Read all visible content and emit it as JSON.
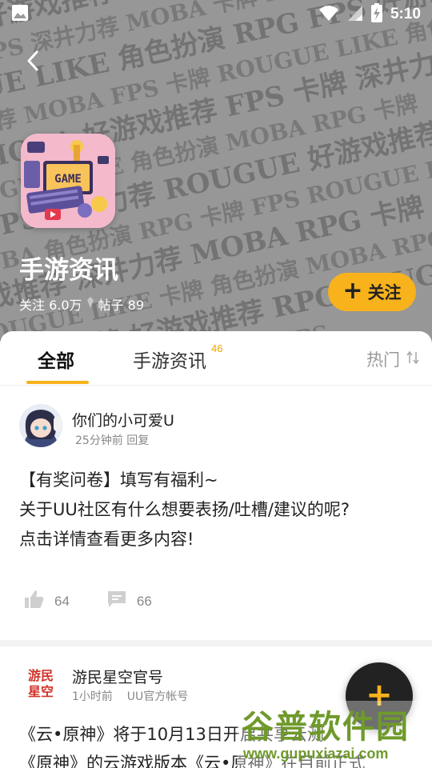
{
  "status_bar": {
    "time": "5:10"
  },
  "background_words": [
    "MOBA 好游戏推荐 角色扮演 卡牌 ROUGUE LIKE",
    "RPG FPS 深井力荐 MOBA 卡牌 ROUGUE",
    "ROUGUE LIKE 角色扮演 RPG FPS 好游戏推荐",
    "深井力荐 MOBA FPS 卡牌 ROUGUE LIKE 角色扮演",
    "RPG MOBA 好游戏推荐 FPS 卡牌 深井力荐",
    "ROUGUE LIKE 角色扮演 MOBA RPG 卡牌",
    "卡牌 FPS 深井力荐 ROUGUE 好游戏推荐 RPG",
    "MOBA 角色扮演 RPG 卡牌 FPS ROUGUE LIKE",
    "好游戏推荐 深井力荐 MOBA RPG 卡牌 FPS",
    "ROUGUE LIKE 卡牌 角色扮演 MOBA RPG",
    "FPS 深井力荐 好游戏推荐 RPG ROUGUE",
    "MOBA 卡牌 角色扮演 RPG FPS"
  ],
  "community": {
    "icon_label": "GAME",
    "title": "手游资讯",
    "followers_label": "关注 6.0万",
    "posts_label": "帖子 89",
    "follow_button": "关注"
  },
  "tabs": {
    "all": "全部",
    "news": "手游资讯",
    "news_badge": "46",
    "sort_label": "热门"
  },
  "posts": [
    {
      "author": "你们的小可爱U",
      "time": "25分钟前 回复",
      "lines": [
        "【有奖问卷】填写有福利~",
        "关于UU社区有什么想要表扬/吐槽/建议的呢?",
        "点击详情查看更多内容!"
      ],
      "likes": "64",
      "comments": "66"
    },
    {
      "author": "游民星空官号",
      "avatar_text_1": "游民",
      "avatar_text_2": "星空",
      "time": "1小时前",
      "badge": "UU官方帐号",
      "lines": [
        "《云•原神》将于10月13日开启共享云测",
        "《原神》的云游戏版本《云•原神》在目前正式"
      ]
    }
  ],
  "fab_label": "+",
  "watermark": {
    "title": "谷普软件园",
    "url": "www.gupuxiazai.com"
  },
  "colors": {
    "accent": "#f7b21c",
    "header_bg": "#9a9a9a"
  }
}
